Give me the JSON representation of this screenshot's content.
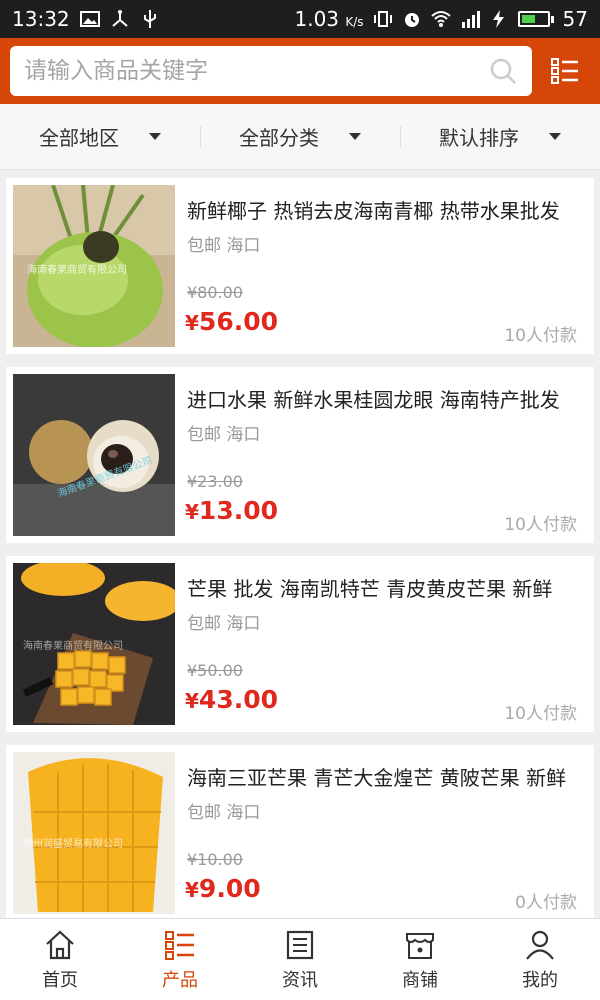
{
  "status_bar": {
    "time": "13:32",
    "network_speed": "1.03",
    "network_unit": "K/s",
    "battery": "57",
    "battery_level": 0.57,
    "left_icons": [
      "image-icon",
      "usb-share-icon",
      "usb-icon"
    ],
    "right_icons": [
      "vibrate-icon",
      "alarm-icon",
      "wifi-icon",
      "signal-4g-icon",
      "charging-icon",
      "battery-icon"
    ]
  },
  "header": {
    "search_placeholder": "请输入商品关键字",
    "accent_color": "#d74609"
  },
  "filters": [
    {
      "label": "全部地区"
    },
    {
      "label": "全部分类"
    },
    {
      "label": "默认排序"
    }
  ],
  "products": [
    {
      "title": "新鲜椰子 热销去皮海南青椰 热带水果批发",
      "meta": "包邮 海口",
      "old_price": "¥80.00",
      "price_symbol": "¥",
      "price": "56.00",
      "sold": "10人付款",
      "watermark": "海南春果商贸有限公司"
    },
    {
      "title": "进口水果 新鲜水果桂圆龙眼 海南特产批发",
      "meta": "包邮 海口",
      "old_price": "¥23.00",
      "price_symbol": "¥",
      "price": "13.00",
      "sold": "10人付款",
      "watermark": "海南春果商贸有限公司"
    },
    {
      "title": "芒果 批发 海南凯特芒 青皮黄皮芒果 新鲜",
      "meta": "包邮 海口",
      "old_price": "¥50.00",
      "price_symbol": "¥",
      "price": "43.00",
      "sold": "10人付款",
      "watermark": "海南春果商贸有限公司"
    },
    {
      "title": "海南三亚芒果 青芒大金煌芒 黄陂芒果 新鲜",
      "meta": "包邮 海口",
      "old_price": "¥10.00",
      "price_symbol": "¥",
      "price": "9.00",
      "sold": "0人付款",
      "watermark": "儋州润盛贸易有限公司"
    }
  ],
  "bottom_nav": [
    {
      "label": "首页",
      "icon": "home-icon"
    },
    {
      "label": "产品",
      "icon": "list-icon",
      "active": true
    },
    {
      "label": "资讯",
      "icon": "news-icon"
    },
    {
      "label": "商铺",
      "icon": "store-icon"
    },
    {
      "label": "我的",
      "icon": "user-icon"
    }
  ]
}
